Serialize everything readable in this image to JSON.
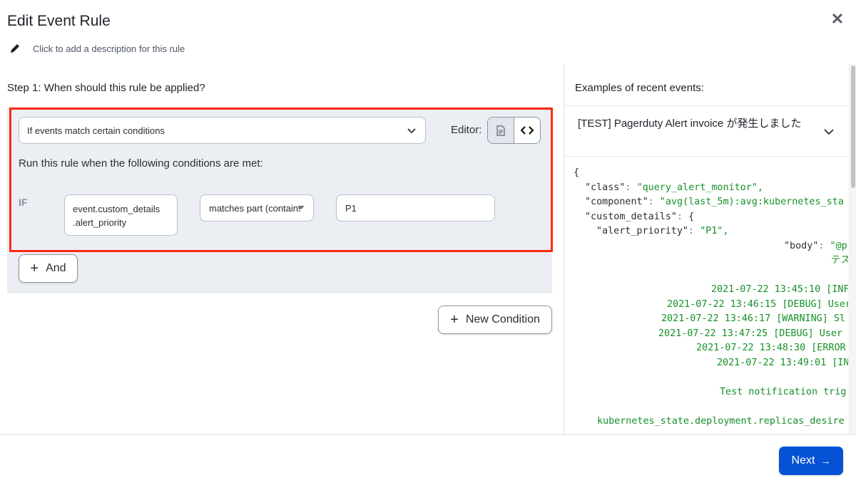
{
  "modal": {
    "title": "Edit Event Rule",
    "close_icon": "close-icon",
    "description_placeholder": "Click to add a description for this rule"
  },
  "step1": {
    "title": "Step 1: When should this rule be applied?",
    "match_select_value": "If events match certain conditions",
    "editor_label": "Editor:",
    "editor_modes": [
      {
        "name": "visual",
        "icon": "document-icon",
        "active": true
      },
      {
        "name": "code",
        "icon": "code-icon",
        "active": false
      }
    ],
    "conditions_text": "Run this rule when the following conditions are met:",
    "condition": {
      "if_label": "IF",
      "field_line1": "event.custom_details",
      "field_line2": ".alert_priority",
      "operator": "matches part (contains)",
      "value": "P1"
    },
    "and_button": "And",
    "new_condition_button": "New Condition",
    "highlight_color": "#ff2a12"
  },
  "examples": {
    "title": "Examples of recent events:",
    "event_title": "[TEST] Pagerduty Alert invoice が発生しました",
    "json_lines": {
      "open": "{",
      "class_key": "\"class\"",
      "class_val": "\"query_alert_monitor\",",
      "component_key": "\"component\"",
      "component_val": "\"avg(last_5m):avg:kubernetes_sta",
      "custom_key": "\"custom_details\"",
      "custom_open": "{",
      "priority_key": "\"alert_priority\"",
      "priority_val": "\"P1\",",
      "body_key": "\"body\"",
      "body_val": "\"@p",
      "body_cont": "テス",
      "log1": "2021-07-22 13:45:10 [INFO",
      "log2": "2021-07-22 13:46:15 [DEBUG] User",
      "log3": "2021-07-22 13:46:17 [WARNING] Sl",
      "log4": "2021-07-22 13:47:25 [DEBUG] User ",
      "log5": "2021-07-22 13:48:30 [ERROR",
      "log6": "2021-07-22 13:49:01 [IN",
      "notif": "Test notification trig",
      "metric": "kubernetes_state.deployment.replicas_desire"
    }
  },
  "footer": {
    "next_button": "Next",
    "next_color": "#0652d6"
  }
}
